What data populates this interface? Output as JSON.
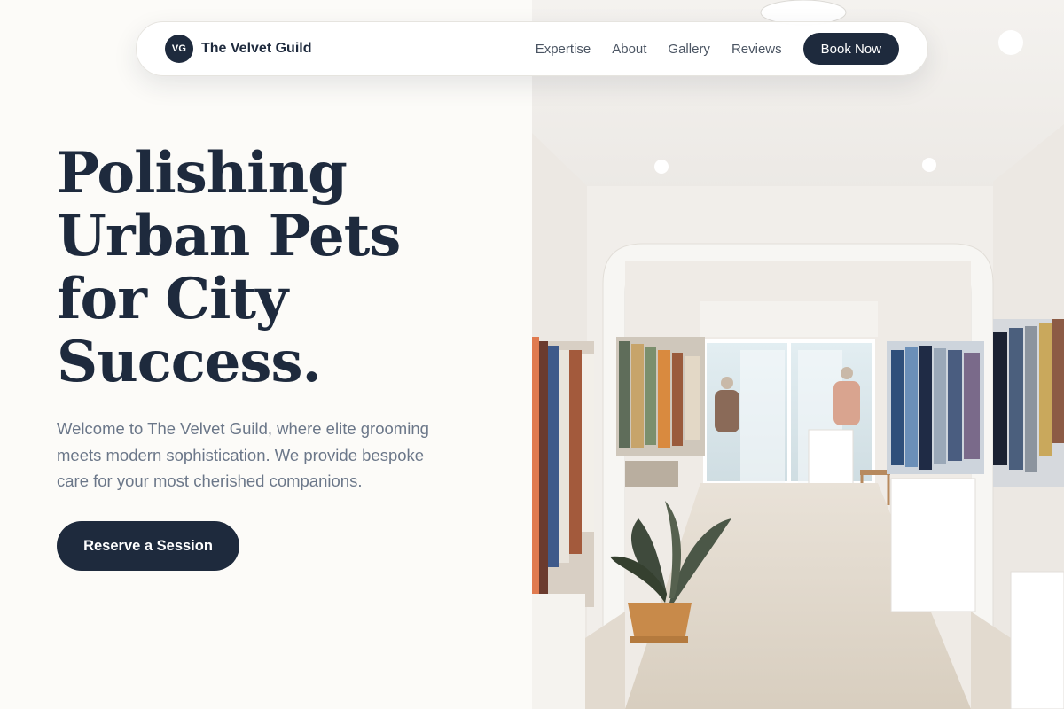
{
  "brand": {
    "initials": "VG",
    "name": "The Velvet Guild"
  },
  "nav": {
    "links": [
      "Expertise",
      "About",
      "Gallery",
      "Reviews"
    ],
    "book_label": "Book Now"
  },
  "hero": {
    "title_lines": [
      "Polishing",
      "Urban Pets",
      "for City",
      "Success."
    ],
    "description": "Welcome to The Velvet Guild, where elite grooming meets modern sophistication. We provide bespoke care for your most cherished companions.",
    "cta_label": "Reserve a Session"
  },
  "colors": {
    "primary": "#1e2a3d",
    "background": "#fcfbf8",
    "muted_text": "#6b7789"
  },
  "hero_image": {
    "subject": "boutique-interior-photo"
  }
}
